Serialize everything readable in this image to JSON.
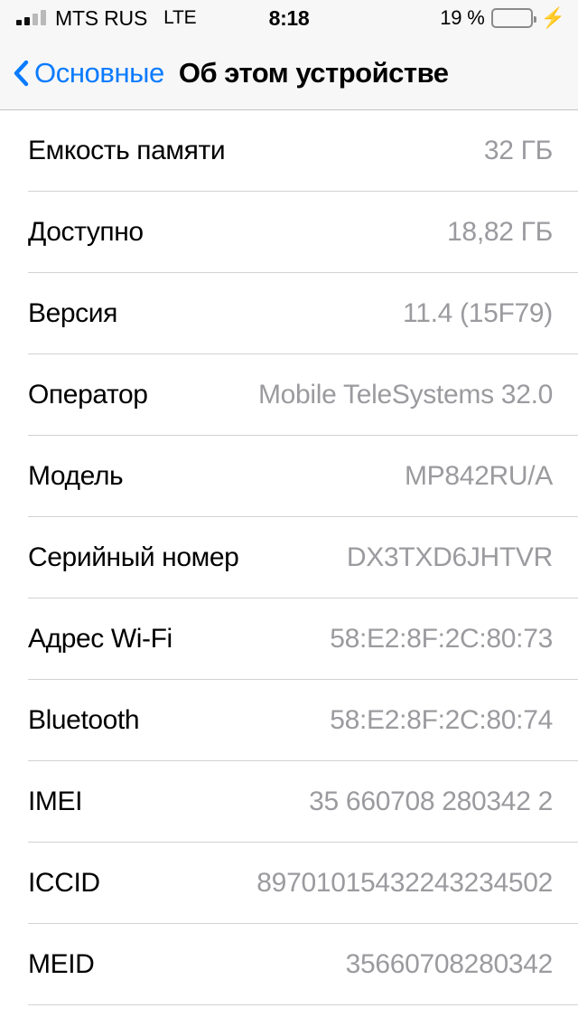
{
  "status_bar": {
    "carrier": "MTS RUS",
    "network": "LTE",
    "time": "8:18",
    "battery_percent": "19 %",
    "battery_level": 19,
    "signal_bars_filled": 2,
    "signal_bars_total": 4,
    "charging": true,
    "icons": {
      "signal": "signal-bars-icon",
      "battery": "battery-icon",
      "bolt": "charging-bolt-icon"
    },
    "colors": {
      "battery_fill": "#ff2d19",
      "battery_outline": "#8a8a8a"
    }
  },
  "nav_bar": {
    "back_label": "Основные",
    "back_icon": "chevron-left-icon",
    "title": "Об этом устройстве",
    "accent_color": "#0a7bff"
  },
  "rows": [
    {
      "label": "Емкость памяти",
      "value": "32 ГБ"
    },
    {
      "label": "Доступно",
      "value": "18,82 ГБ"
    },
    {
      "label": "Версия",
      "value": "11.4 (15F79)"
    },
    {
      "label": "Оператор",
      "value": "Mobile TeleSystems 32.0"
    },
    {
      "label": "Модель",
      "value": "MP842RU/A"
    },
    {
      "label": "Серийный номер",
      "value": "DX3TXD6JHTVR"
    },
    {
      "label": "Адрес Wi-Fi",
      "value": "58:E2:8F:2C:80:73"
    },
    {
      "label": "Bluetooth",
      "value": "58:E2:8F:2C:80:74"
    },
    {
      "label": "IMEI",
      "value": "35 660708 280342 2"
    },
    {
      "label": "ICCID",
      "value": "89701015432243234502"
    },
    {
      "label": "MEID",
      "value": "35660708280342"
    }
  ]
}
